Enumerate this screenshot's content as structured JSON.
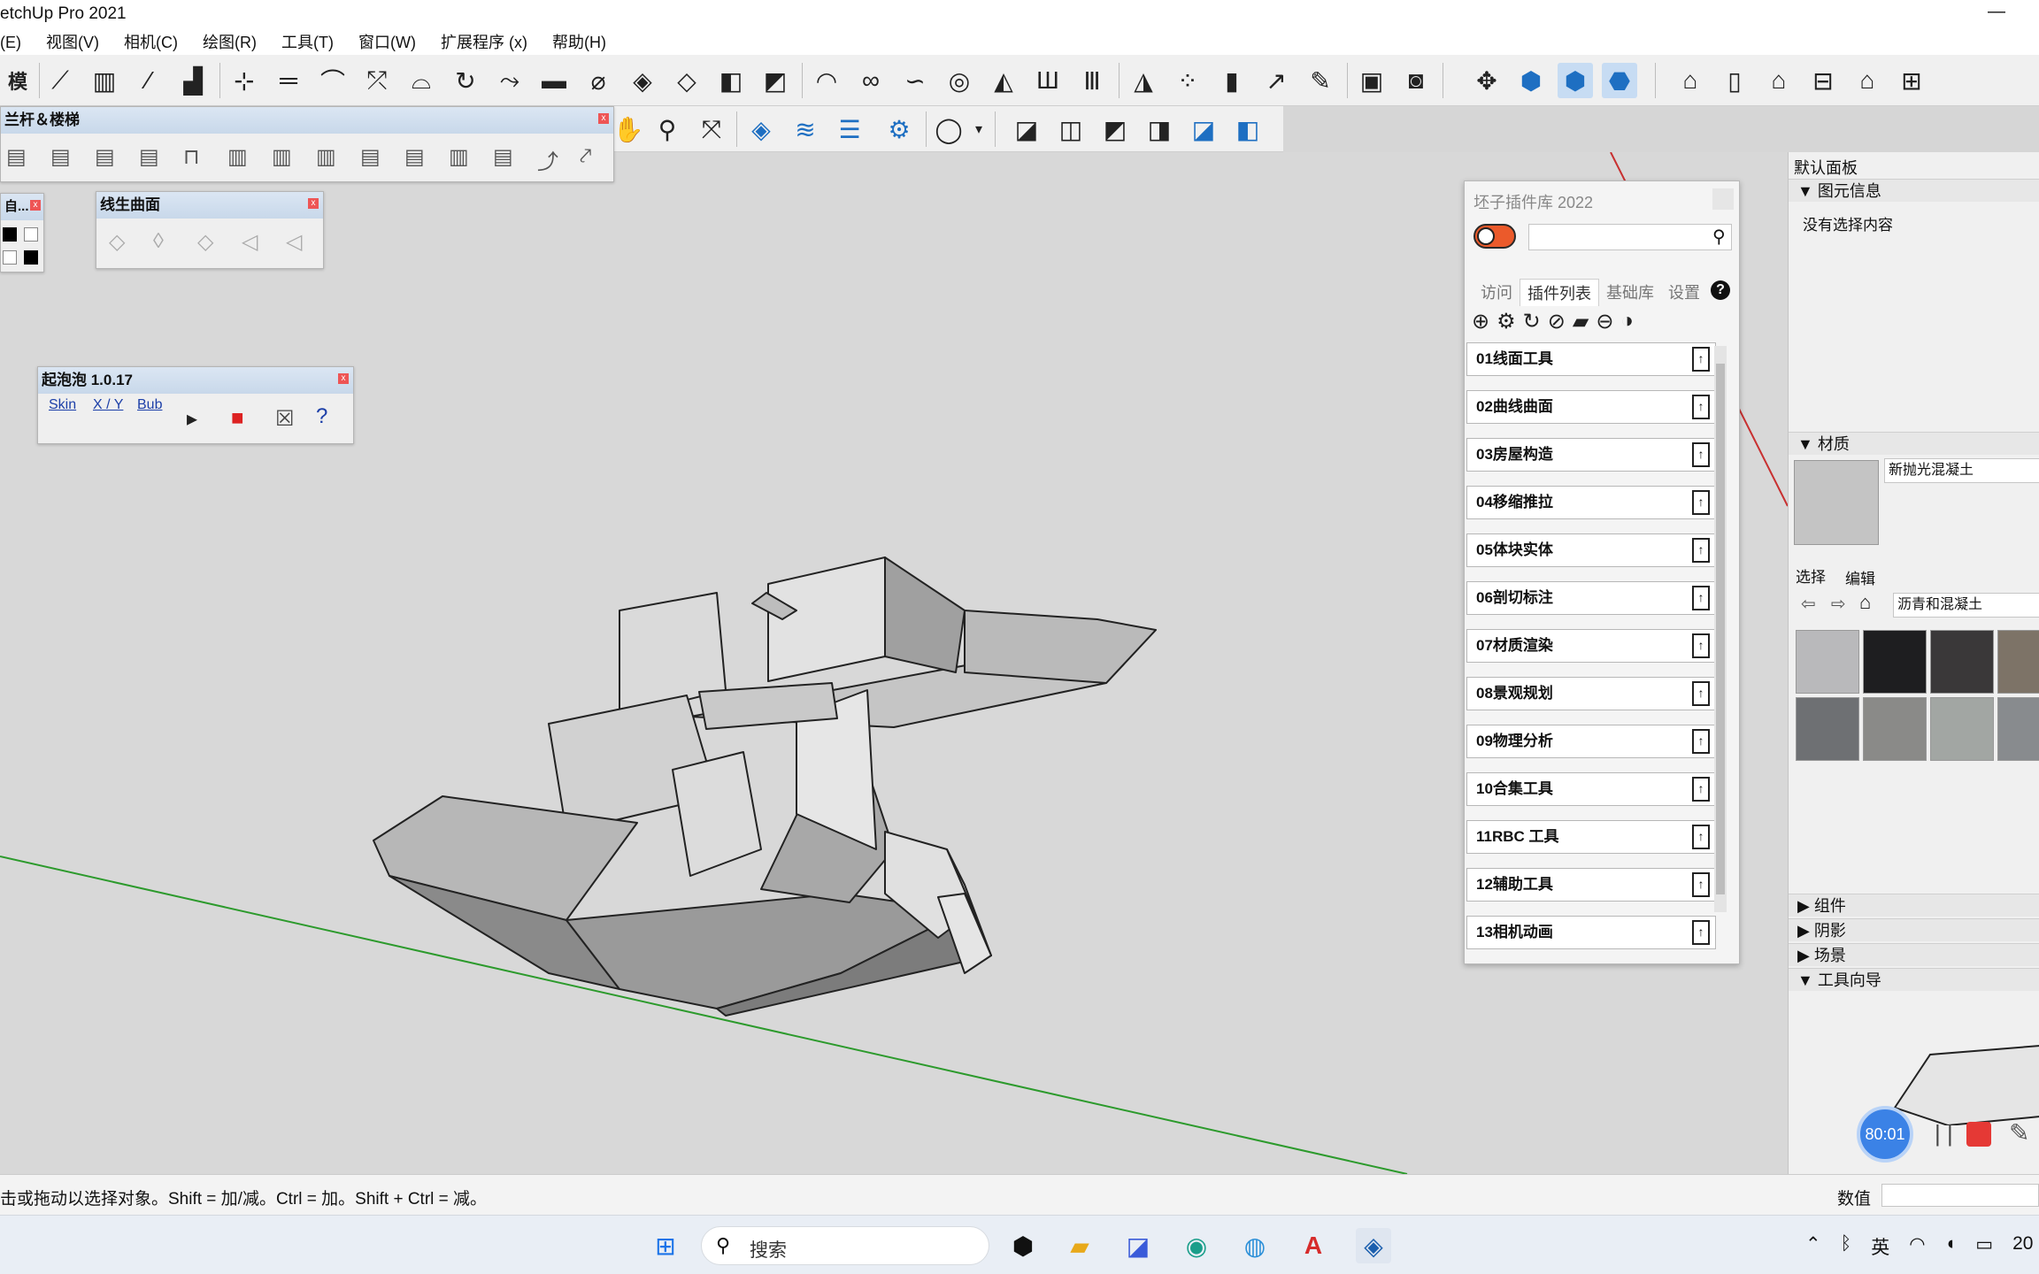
{
  "window": {
    "title": "etchUp Pro 2021",
    "minimize": "—"
  },
  "menu": [
    "(E)",
    "视图(V)",
    "相机(C)",
    "绘图(R)",
    "工具(T)",
    "窗口(W)",
    "扩展程序 (x)",
    "帮助(H)"
  ],
  "floating": {
    "railing": {
      "title": "兰杆＆楼梯",
      "close": "x"
    },
    "color": {
      "title": "自...",
      "close": "x"
    },
    "curve": {
      "title": "线生曲面",
      "close": "x"
    },
    "bubble": {
      "title": "起泡泡 1.0.17",
      "close": "x",
      "labels": [
        "Skin",
        "X / Y",
        "Bub"
      ]
    }
  },
  "plugin_panel": {
    "title": "坯子插件库 2022",
    "search": {
      "value": "",
      "placeholder": ""
    },
    "tabs": [
      "访问",
      "插件列表",
      "基础库",
      "设置"
    ],
    "active_tab": "插件列表",
    "help": "?",
    "items": [
      "01线面工具",
      "02曲线曲面",
      "03房屋构造",
      "04移缩推拉",
      "05体块实体",
      "06剖切标注",
      "07材质渲染",
      "08景观规划",
      "09物理分析",
      "10合集工具",
      "11RBC 工具",
      "12辅助工具",
      "13相机动画"
    ],
    "item_button": "↑"
  },
  "tray": {
    "title": "默认面板",
    "entity_info": {
      "header": "图元信息",
      "content": "没有选择内容"
    },
    "materials": {
      "header": "材质",
      "current": "新抛光混凝土",
      "tabs": [
        "选择",
        "编辑"
      ],
      "library": "沥青和混凝土",
      "swatch_colors": [
        "#b9b9bb",
        "#1e1e20",
        "#3a3839",
        "#7d7367",
        "#6e7073",
        "#8a8a88",
        "#a2a6a3",
        "#888b8e"
      ]
    },
    "sections": [
      "组件",
      "阴影",
      "场景",
      "工具向导"
    ]
  },
  "status": {
    "message": "击或拖动以选择对象。Shift = 加/减。Ctrl = 加。Shift + Ctrl = 减。",
    "measure_label": "数值",
    "measure_value": ""
  },
  "taskbar": {
    "search_label": "搜索",
    "ime": "英",
    "clock_partial": "20"
  },
  "recorder": {
    "time": "80:01",
    "pause": "| |"
  },
  "colors": {
    "accent": "#1e6fc2",
    "toggle": "#eb5a2b",
    "record": "#e53935",
    "timer": "#3b82e6"
  }
}
